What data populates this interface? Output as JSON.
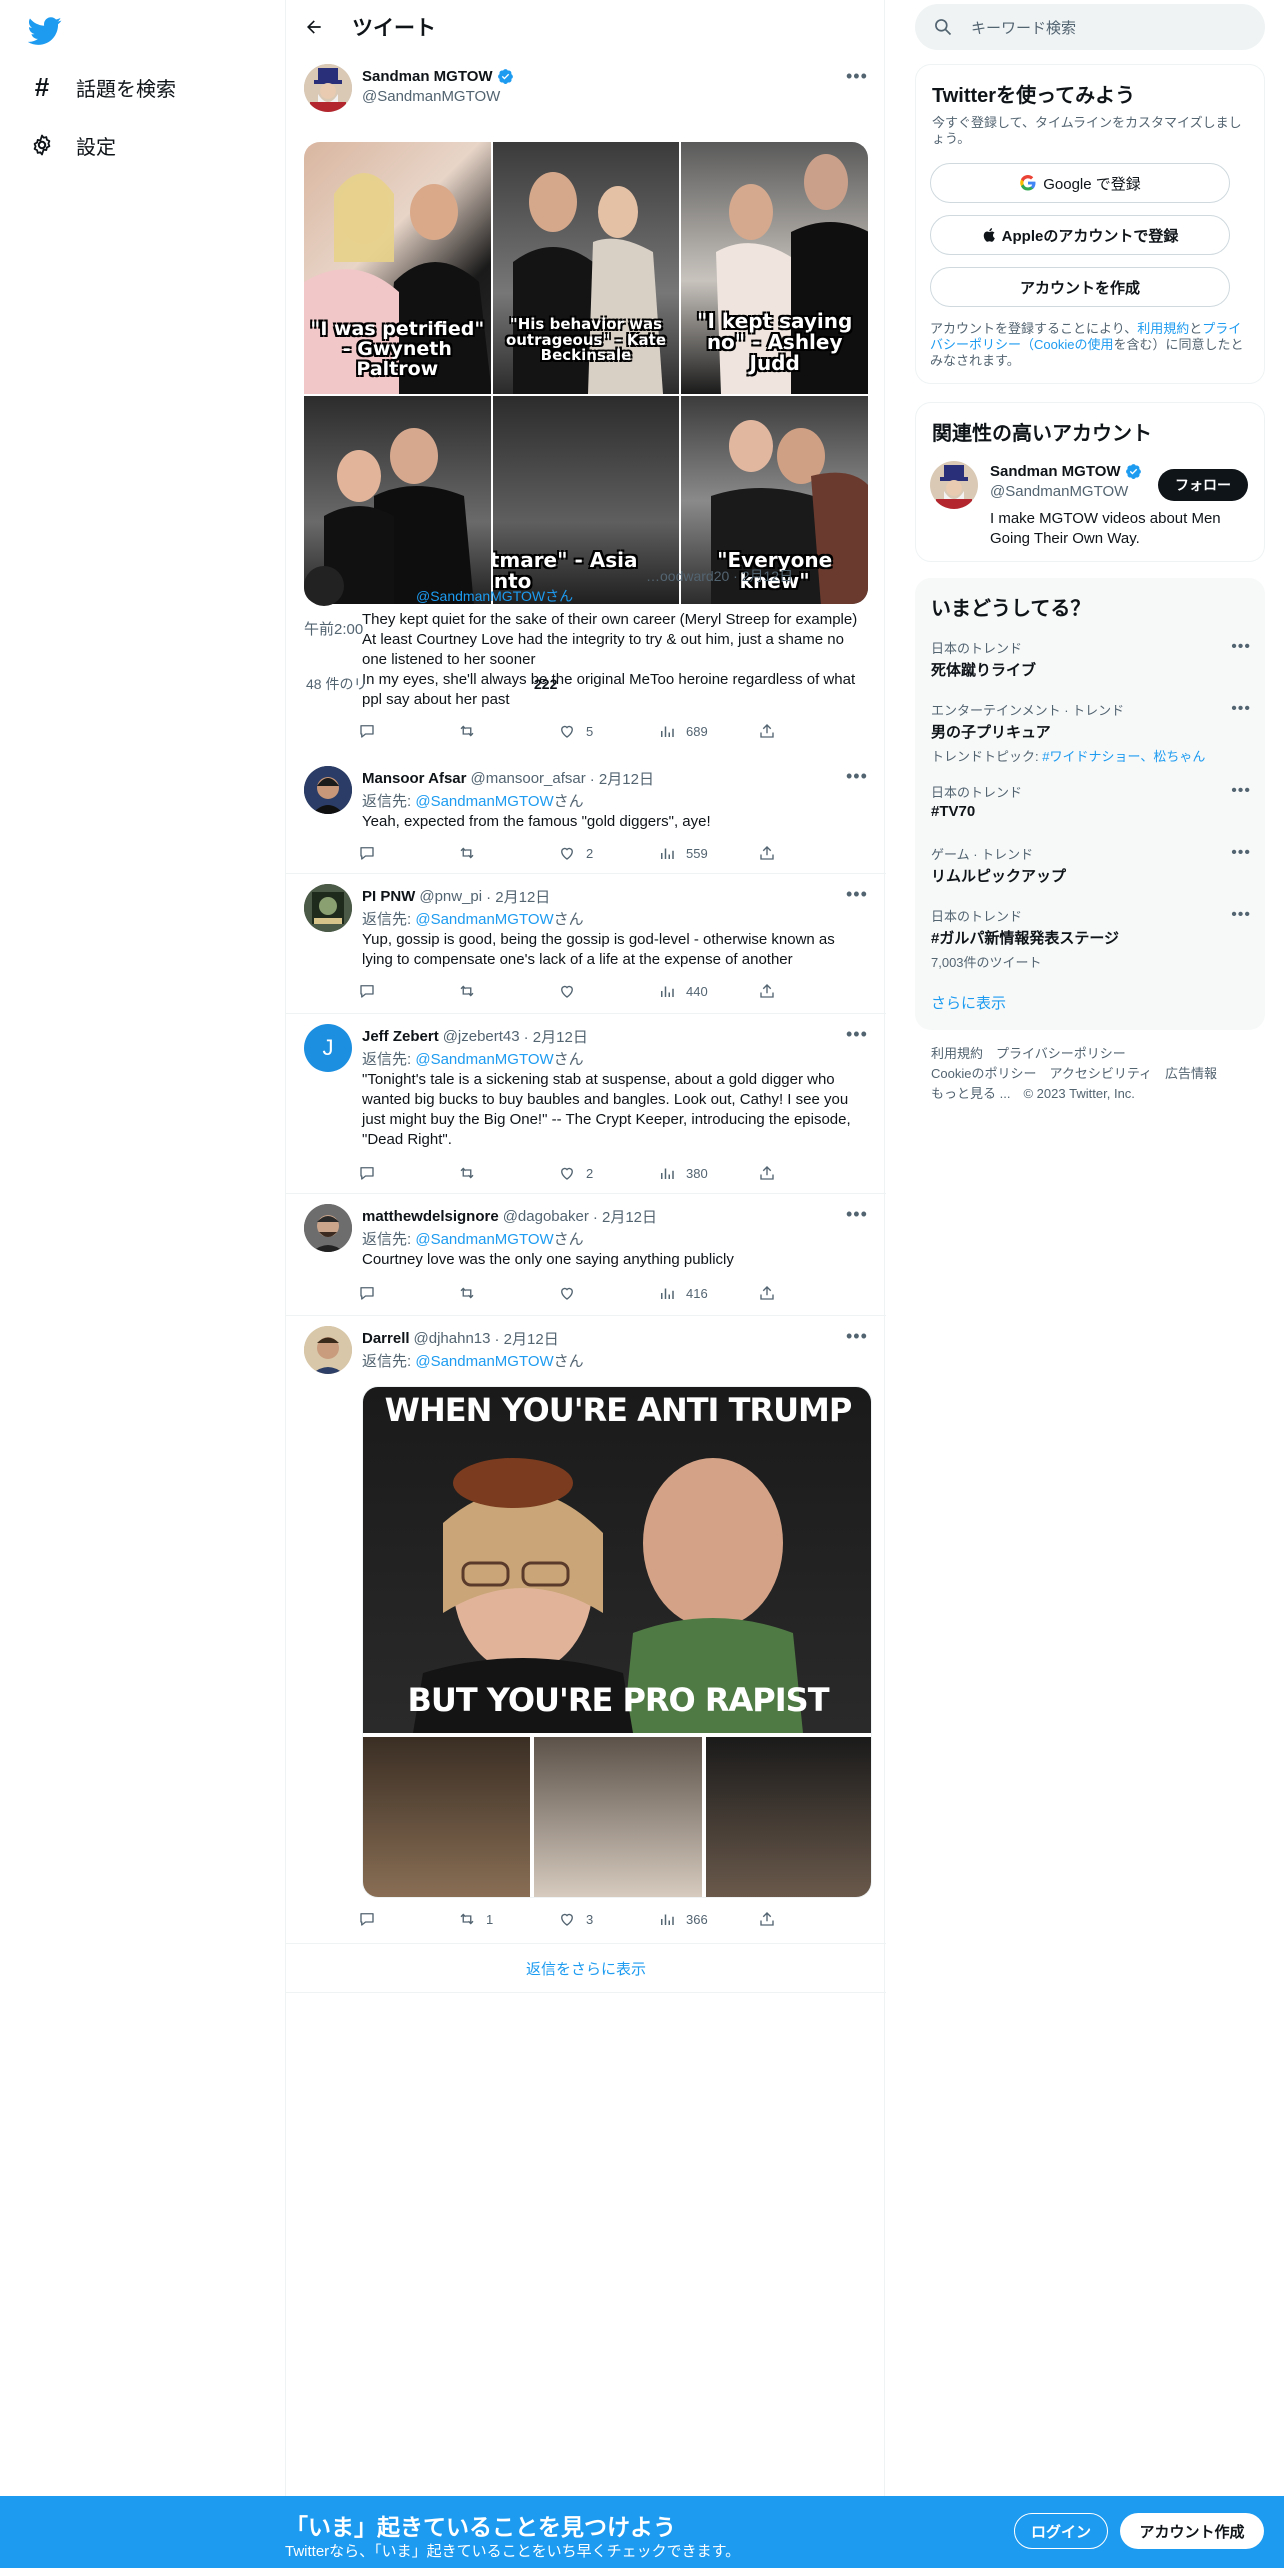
{
  "nav": {
    "explore_label": "話題を検索",
    "settings_label": "設定"
  },
  "header": {
    "title": "ツイート"
  },
  "focal_tweet": {
    "author_name": "Sandman MGTOW",
    "author_handle": "@SandmanMGTOW",
    "captions": [
      "\"I was petrified\" - Gwyneth Paltrow",
      "\"His behavior was outrageous\" - Kate Beckinsale",
      "\"I kept saying no\" - Ashley Judd",
      "\"It was a nightmare\" - Asia Argento",
      "\"Everyone knew\""
    ],
    "time_fragment": "午前2:00",
    "stats_fragment": "48 件のリ",
    "stats_fragment2": "222",
    "overlapping_reply": {
      "handle": "…oodward20 · 2月12日",
      "reply_to": "@SandmanMGTOWさん",
      "text_lines": [
        "They kept quiet for the sake of their own career (Meryl Streep for example)",
        "At least Courtney Love had the integrity to try & out him, just a shame no one listened to her sooner",
        "In my eyes, she'll always be the original MeToo heroine regardless of what ppl say about her past"
      ],
      "likes": "5",
      "views": "689"
    }
  },
  "replies": [
    {
      "name": "Mansoor Afsar",
      "handle": "@mansoor_afsar",
      "date": "· 2月12日",
      "reply_prefix": "返信先: ",
      "reply_to": "@SandmanMGTOW",
      "reply_suffix": "さん",
      "text": "Yeah, expected from the famous \"gold diggers\", aye!",
      "replies": "",
      "retweets": "",
      "likes": "2",
      "views": "559"
    },
    {
      "name": "PI PNW",
      "handle": "@pnw_pi",
      "date": "· 2月12日",
      "reply_prefix": "返信先: ",
      "reply_to": "@SandmanMGTOW",
      "reply_suffix": "さん",
      "text": "Yup, gossip is good, being the gossip is god-level - otherwise known as lying to compensate one's lack of a life at the expense of another",
      "replies": "",
      "retweets": "",
      "likes": "",
      "views": "440"
    },
    {
      "name": "Jeff Zebert",
      "handle": "@jzebert43",
      "date": "· 2月12日",
      "reply_prefix": "返信先: ",
      "reply_to": "@SandmanMGTOW",
      "reply_suffix": "さん",
      "text": "\"Tonight's tale is a sickening stab at suspense, about a gold digger who wanted big bucks to buy baubles and bangles. Look out, Cathy! I see you just might buy the Big One!\" -- The Crypt Keeper, introducing the episode, \"Dead Right\".",
      "replies": "",
      "retweets": "",
      "likes": "2",
      "views": "380"
    },
    {
      "name": "matthewdelsignore",
      "handle": "@dagobaker",
      "date": "· 2月12日",
      "reply_prefix": "返信先: ",
      "reply_to": "@SandmanMGTOW",
      "reply_suffix": "さん",
      "text": "Courtney love was the only one saying anything publicly",
      "replies": "",
      "retweets": "",
      "likes": "",
      "views": "416"
    },
    {
      "name": "Darrell",
      "handle": "@djhahn13",
      "date": "· 2月12日",
      "reply_prefix": "返信先: ",
      "reply_to": "@SandmanMGTOW",
      "reply_suffix": "さん",
      "text": "",
      "meme_top": "WHEN YOU'RE ANTI TRUMP",
      "meme_bottom": "BUT YOU'RE PRO RAPIST",
      "replies": "",
      "retweets": "1",
      "likes": "3",
      "views": "366"
    }
  ],
  "jeff_avatar_letter": "J",
  "show_more_replies": "返信をさらに表示",
  "sidebar": {
    "search_placeholder": "キーワード検索",
    "signup": {
      "title": "Twitterを使ってみよう",
      "subtitle": "今すぐ登録して、タイムラインをカスタマイズしましょう。",
      "google": "Google で登録",
      "apple": "Appleのアカウントで登録",
      "create": "アカウントを作成",
      "terms_pre": "アカウントを登録することにより、",
      "terms_link1": "利用規約",
      "terms_mid": "と",
      "terms_link2": "プライバシーポリシー（Cookieの使用",
      "terms_post": "を含む）に同意したとみなされます。"
    },
    "related": {
      "title": "関連性の高いアカウント",
      "name": "Sandman MGTOW",
      "handle": "@SandmanMGTOW",
      "bio": "I make MGTOW videos about Men Going Their Own Way.",
      "follow": "フォロー"
    },
    "trends": {
      "title": "いまどうしてる？",
      "items": [
        {
          "category": "日本のトレンド",
          "title": "死体蹴りライブ",
          "sub": ""
        },
        {
          "category": "エンターテインメント · トレンド",
          "title": "男の子プリキュア",
          "sub_prefix": "トレンドトピック: ",
          "sub_link": "#ワイドナショー、松ちゃん"
        },
        {
          "category": "日本のトレンド",
          "title": "#TV70",
          "sub": ""
        },
        {
          "category": "ゲーム · トレンド",
          "title": "リムルピックアップ",
          "sub": ""
        },
        {
          "category": "日本のトレンド",
          "title": "#ガルパ新情報発表ステージ",
          "sub": "7,003件のツイート"
        }
      ],
      "show_more": "さらに表示"
    },
    "footer": {
      "line1": "利用規約　プライバシーポリシー",
      "line2": "Cookieのポリシー　アクセシビリティ　広告情報",
      "line3": "もっと見る ...　© 2023 Twitter, Inc."
    }
  },
  "bottom_bar": {
    "title": "「いま」起きていることを見つけよう",
    "subtitle": "Twitterなら、「いま」起きていることをいち早くチェックできます。",
    "login": "ログイン",
    "signup": "アカウント作成"
  },
  "colors": {
    "accent": "#1d9bf0",
    "text": "#0f1419",
    "muted": "#536471"
  }
}
